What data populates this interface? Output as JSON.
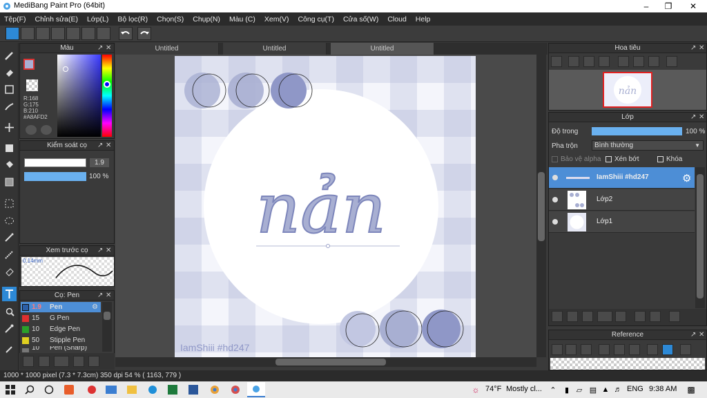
{
  "window": {
    "title": "MediBang Paint Pro (64bit)"
  },
  "menu": [
    "Tệp(F)",
    "Chỉnh sửa(E)",
    "Lớp(L)",
    "Bộ lọc(R)",
    "Chọn(S)",
    "Chụp(N)",
    "Màu (C)",
    "Xem(V)",
    "Công cụ(T)",
    "Cửa số(W)",
    "Cloud",
    "Help"
  ],
  "tabs": [
    "Untitled",
    "Untitled",
    "Untitled"
  ],
  "color_panel": {
    "title": "Màu",
    "r": "R:168",
    "g": "G:175",
    "b": "B:210",
    "hex": "#A8AFD2",
    "current": "#A8AFD2"
  },
  "brush_control": {
    "title": "Kiểm soát cọ",
    "size": "1.9",
    "opacity": "100 %"
  },
  "brush_preview": {
    "title": "Xem trước cọ",
    "size": "0.14mm"
  },
  "brushes": {
    "title": "Cọ: Pen",
    "items": [
      {
        "size": "1.9",
        "name": "Pen",
        "color": "#2b5fa8"
      },
      {
        "size": "15",
        "name": "G Pen",
        "color": "#e03030"
      },
      {
        "size": "10",
        "name": "Edge Pen",
        "color": "#2aa02a"
      },
      {
        "size": "50",
        "name": "Stipple Pen",
        "color": "#e0d020"
      },
      {
        "size": "10",
        "name": "Pen (Sharp)",
        "color": "#777777"
      }
    ]
  },
  "artwork": {
    "word": "nản",
    "signature": "IamShiii #hd247"
  },
  "navigator": {
    "title": "Hoa tiêu"
  },
  "layer_panel": {
    "title": "Lớp",
    "opacity_label": "Độ trong",
    "opacity_value": "100 %",
    "blend_label": "Pha trộn",
    "blend_value": "Bình thường",
    "protect_alpha": "Bảo vệ alpha",
    "clipping": "Xén bớt",
    "lock": "Khóa",
    "layers": [
      "IamShiii #hd247",
      "Lớp2",
      "Lớp1"
    ]
  },
  "reference": {
    "title": "Reference"
  },
  "status": "1000 * 1000 pixel  (7.3 * 7.3cm)  350 dpi  54 %  ( 1163, 779 )",
  "taskbar": {
    "weather_temp": "74°F",
    "weather_text": "Mostly cl...",
    "lang": "ENG",
    "time": "9:38 AM"
  },
  "colors": {
    "accent": "#2d89d6",
    "layer_selected": "#4d8ed6",
    "plaid": "#a8afd2"
  }
}
